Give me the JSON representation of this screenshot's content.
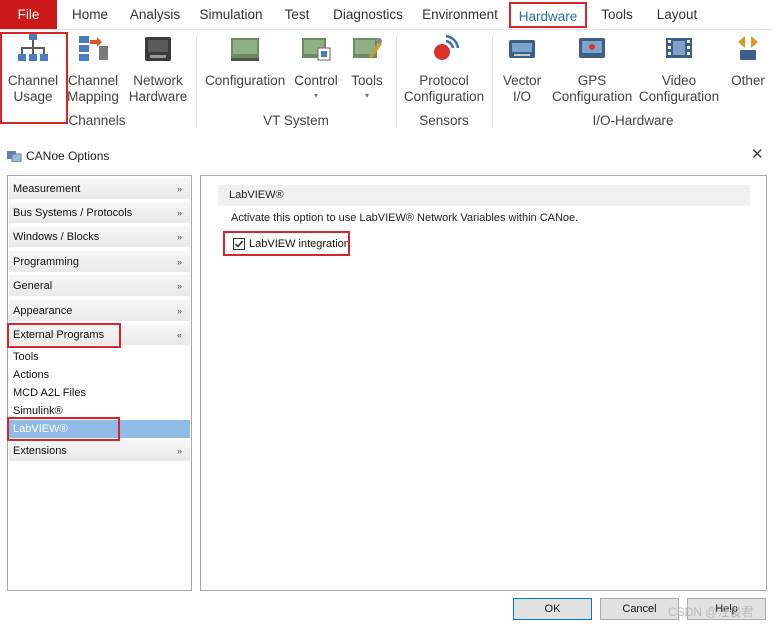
{
  "menu": {
    "tabs": [
      "File",
      "Home",
      "Analysis",
      "Simulation",
      "Test",
      "Diagnostics",
      "Environment",
      "Hardware",
      "Tools",
      "Layout"
    ],
    "active_tab": "Hardware"
  },
  "ribbon": {
    "buttons": [
      {
        "label": "Channel\nUsage",
        "icon": "channel-usage-icon"
      },
      {
        "label": "Channel\nMapping",
        "icon": "channel-mapping-icon"
      },
      {
        "label": "Network\nHardware",
        "icon": "network-hardware-icon"
      },
      {
        "label": "Configuration",
        "icon": "vt-configuration-icon"
      },
      {
        "label": "Control",
        "icon": "vt-control-icon",
        "dropdown": "▾"
      },
      {
        "label": "Tools",
        "icon": "vt-tools-icon",
        "dropdown": "▾"
      },
      {
        "label": "Protocol\nConfiguration",
        "icon": "protocol-configuration-icon"
      },
      {
        "label": "Vector\nI/O",
        "icon": "vector-io-icon"
      },
      {
        "label": "GPS\nConfiguration",
        "icon": "gps-configuration-icon"
      },
      {
        "label": "Video\nConfiguration",
        "icon": "video-configuration-icon"
      },
      {
        "label": "Other",
        "icon": "other-icon"
      }
    ],
    "groups": [
      "Channels",
      "VT System",
      "Sensors",
      "I/O-Hardware"
    ]
  },
  "dialog": {
    "title": "CANoe Options",
    "close_glyph": "✕"
  },
  "nav": {
    "sections": [
      {
        "label": "Measurement",
        "chevron": "»"
      },
      {
        "label": "Bus Systems / Protocols",
        "chevron": "»"
      },
      {
        "label": "Windows / Blocks",
        "chevron": "»"
      },
      {
        "label": "Programming",
        "chevron": "»"
      },
      {
        "label": "General",
        "chevron": "»"
      },
      {
        "label": "Appearance",
        "chevron": "»"
      },
      {
        "label": "External Programs",
        "chevron": "«"
      }
    ],
    "sub_items": [
      "Tools",
      "Actions",
      "MCD A2L Files",
      "Simulink®",
      "LabVIEW®"
    ],
    "selected": "LabVIEW®",
    "last_section": {
      "label": "Extensions",
      "chevron": "»"
    }
  },
  "panel": {
    "header": "LabVIEW®",
    "description": "Activate this option to use LabVIEW® Network Variables within CANoe.",
    "checkbox": {
      "label": "LabVIEW integration",
      "checked": true
    }
  },
  "buttons": {
    "ok": "OK",
    "cancel": "Cancel",
    "help": "Help"
  },
  "watermark": "CSDN @汪俊君",
  "colors": {
    "accent_red": "#d9242a",
    "file_tab": "#cc1a1a",
    "active_tab_text": "#2f6bb5",
    "selection": "#8fbbe6",
    "default_button_border": "#0078d7"
  }
}
